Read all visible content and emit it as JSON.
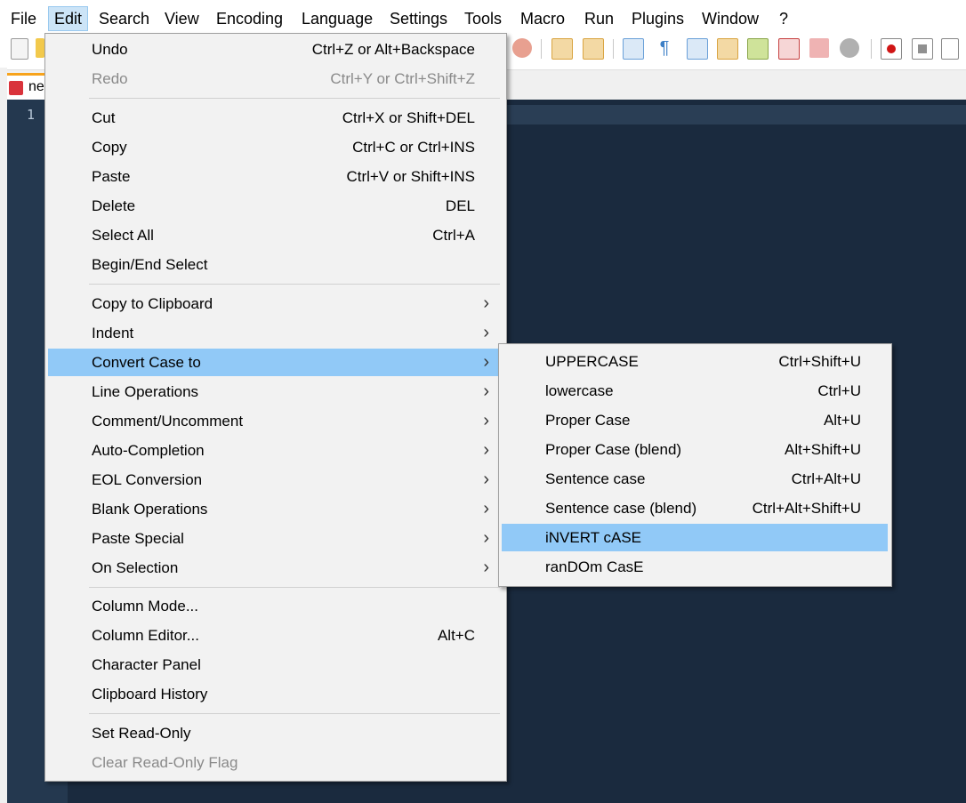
{
  "menubar": {
    "items": [
      "File",
      "Edit",
      "Search",
      "View",
      "Encoding",
      "Language",
      "Settings",
      "Tools",
      "Macro",
      "Run",
      "Plugins",
      "Window",
      "?"
    ]
  },
  "tab": {
    "label": "ne"
  },
  "editor": {
    "line_number": "1"
  },
  "edit_menu": {
    "items": [
      {
        "label": "Undo",
        "shortcut": "Ctrl+Z or Alt+Backspace"
      },
      {
        "label": "Redo",
        "shortcut": "Ctrl+Y or Ctrl+Shift+Z",
        "disabled": true
      },
      {
        "label": "Cut",
        "shortcut": "Ctrl+X or Shift+DEL"
      },
      {
        "label": "Copy",
        "shortcut": "Ctrl+C or Ctrl+INS"
      },
      {
        "label": "Paste",
        "shortcut": "Ctrl+V or Shift+INS"
      },
      {
        "label": "Delete",
        "shortcut": "DEL"
      },
      {
        "label": "Select All",
        "shortcut": "Ctrl+A"
      },
      {
        "label": "Begin/End Select",
        "shortcut": ""
      },
      {
        "label": "Copy to Clipboard",
        "submenu": true
      },
      {
        "label": "Indent",
        "submenu": true
      },
      {
        "label": "Convert Case to",
        "submenu": true,
        "highlighted": true
      },
      {
        "label": "Line Operations",
        "submenu": true
      },
      {
        "label": "Comment/Uncomment",
        "submenu": true
      },
      {
        "label": "Auto-Completion",
        "submenu": true
      },
      {
        "label": "EOL Conversion",
        "submenu": true
      },
      {
        "label": "Blank Operations",
        "submenu": true
      },
      {
        "label": "Paste Special",
        "submenu": true
      },
      {
        "label": "On Selection",
        "submenu": true
      },
      {
        "label": "Column Mode...",
        "shortcut": ""
      },
      {
        "label": "Column Editor...",
        "shortcut": "Alt+C"
      },
      {
        "label": "Character Panel",
        "shortcut": ""
      },
      {
        "label": "Clipboard History",
        "shortcut": ""
      },
      {
        "label": "Set Read-Only",
        "shortcut": ""
      },
      {
        "label": "Clear Read-Only Flag",
        "shortcut": "",
        "disabled": true
      }
    ]
  },
  "convert_case_menu": {
    "items": [
      {
        "label": "UPPERCASE",
        "shortcut": "Ctrl+Shift+U"
      },
      {
        "label": "lowercase",
        "shortcut": "Ctrl+U"
      },
      {
        "label": "Proper Case",
        "shortcut": "Alt+U"
      },
      {
        "label": "Proper Case (blend)",
        "shortcut": "Alt+Shift+U"
      },
      {
        "label": "Sentence case",
        "shortcut": "Ctrl+Alt+U"
      },
      {
        "label": "Sentence case (blend)",
        "shortcut": "Ctrl+Alt+Shift+U"
      },
      {
        "label": "iNVERT cASE",
        "shortcut": "",
        "highlighted": true
      },
      {
        "label": "ranDOm CasE",
        "shortcut": ""
      }
    ]
  },
  "toolbar": {
    "icons": [
      "new-file-icon",
      "open-file-icon",
      "find-icon",
      "zoom-in-icon",
      "zoom-out-icon",
      "wrap-icon",
      "show-all-chars-icon",
      "indent-guide-icon",
      "doc-map-icon",
      "function-list-icon",
      "folder-workspace-icon",
      "pdf-icon",
      "folder-icon",
      "monitor-icon",
      "record-macro-icon",
      "stop-macro-icon",
      "play-macro-icon"
    ]
  },
  "colors": {
    "menu_highlight": "#91c9f7",
    "editor_bg": "#1a2a3e",
    "tab_accent": "#f7a31c"
  }
}
